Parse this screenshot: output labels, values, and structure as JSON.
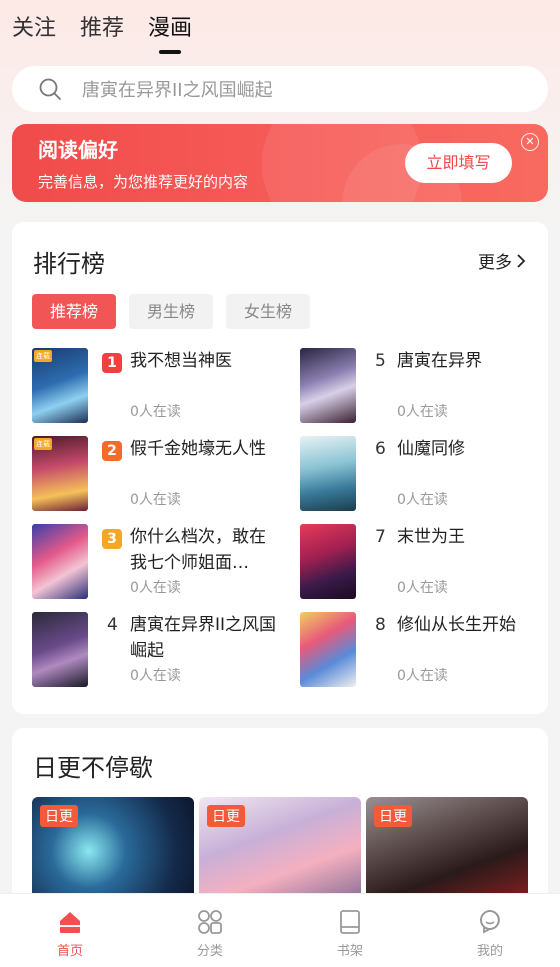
{
  "top_tabs": [
    "关注",
    "推荐",
    "漫画"
  ],
  "active_top_tab": 2,
  "search": {
    "placeholder": "唐寅在异界II之风国崛起"
  },
  "banner": {
    "title": "阅读偏好",
    "desc": "完善信息，为您推荐更好的内容",
    "button": "立即填写"
  },
  "ranking": {
    "title": "排行榜",
    "more": "更多",
    "tabs": [
      "推荐榜",
      "男生榜",
      "女生榜"
    ],
    "active_tab": 0,
    "left": [
      {
        "rank": "1",
        "name": "我不想当神医",
        "reading": "0人在读"
      },
      {
        "rank": "2",
        "name": "假千金她壕无人性",
        "reading": "0人在读"
      },
      {
        "rank": "3",
        "name": "你什么档次，敢在我七个师姐面…",
        "reading": "0人在读"
      },
      {
        "rank": "4",
        "name": "唐寅在异界II之风国崛起",
        "reading": "0人在读"
      }
    ],
    "right": [
      {
        "rank": "5",
        "name": "唐寅在异界",
        "reading": "0人在读"
      },
      {
        "rank": "6",
        "name": "仙魔同修",
        "reading": "0人在读"
      },
      {
        "rank": "7",
        "name": "末世为王",
        "reading": "0人在读"
      },
      {
        "rank": "8",
        "name": "修仙从长生开始",
        "reading": "0人在读"
      }
    ]
  },
  "daily": {
    "title": "日更不停歇",
    "tag": "日更",
    "count": 3
  },
  "bottom_nav": [
    {
      "label": "首页",
      "icon": "home-icon",
      "active": true
    },
    {
      "label": "分类",
      "icon": "category-icon",
      "active": false
    },
    {
      "label": "书架",
      "icon": "bookshelf-icon",
      "active": false
    },
    {
      "label": "我的",
      "icon": "profile-icon",
      "active": false
    }
  ],
  "colors": {
    "accent": "#f25555",
    "rank1": "#f04040",
    "rank2": "#f36a2c",
    "rank3": "#f5a623"
  }
}
